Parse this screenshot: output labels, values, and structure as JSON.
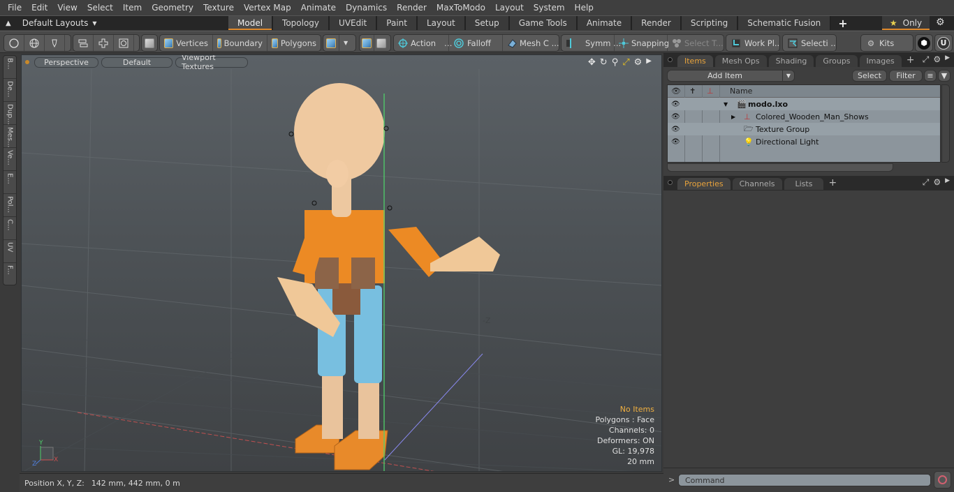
{
  "menu": [
    "File",
    "Edit",
    "View",
    "Select",
    "Item",
    "Geometry",
    "Texture",
    "Vertex Map",
    "Animate",
    "Dynamics",
    "Render",
    "MaxToModo",
    "Layout",
    "System",
    "Help"
  ],
  "layouts": {
    "label": "Default Layouts"
  },
  "layout_tabs": [
    "Model",
    "Topology",
    "UVEdit",
    "Paint",
    "Layout",
    "Setup",
    "Game Tools",
    "Animate",
    "Render",
    "Scripting",
    "Schematic Fusion"
  ],
  "active_layout_tab": "Model",
  "only_label": "Only",
  "toolbar": {
    "vertices": "Vertices",
    "boundary": "Boundary",
    "polygons": "Polygons",
    "action": "Action",
    "falloff": "Falloff",
    "mesh_constraint": "Mesh C ...",
    "symmetry": "Symm ...",
    "snapping": "Snapping",
    "select_tool": "Select T...",
    "work_plane": "Work Pl...",
    "selection_sets": "Selecti ...",
    "kits": "Kits"
  },
  "left_palette": [
    "B...",
    "De...",
    "Dup...",
    "Mes...",
    "Ve...",
    "E...",
    "Pol...",
    "C...",
    "UV",
    "F..."
  ],
  "viewport": {
    "view": "Perspective",
    "shading": "Default",
    "textures": "Viewport Textures",
    "axis_label": "-Z",
    "info": {
      "items": "No Items",
      "polygons": "Polygons : Face",
      "channels": "Channels: 0",
      "deformers": "Deformers: ON",
      "gl": "GL: 19,978",
      "grid": "20 mm"
    }
  },
  "status": {
    "label": "Position X, Y, Z:",
    "value": "142 mm, 442 mm, 0 m"
  },
  "items_panel": {
    "tabs": [
      "Items",
      "Mesh Ops",
      "Shading",
      "Groups",
      "Images"
    ],
    "active_tab": "Items",
    "add_item": "Add Item",
    "select": "Select",
    "filter": "Filter",
    "column_name": "Name",
    "rows": [
      {
        "name": "modo.lxo",
        "icon": "scene-icon",
        "depth": 0
      },
      {
        "name": "Colored_Wooden_Man_Shows",
        "icon": "locator-icon",
        "depth": 1
      },
      {
        "name": "Texture Group",
        "icon": "folder-icon",
        "depth": 1
      },
      {
        "name": "Directional Light",
        "icon": "light-icon",
        "depth": 1
      }
    ]
  },
  "properties_panel": {
    "tabs": [
      "Properties",
      "Channels",
      "Lists"
    ],
    "active_tab": "Properties"
  },
  "command": {
    "placeholder": "Command"
  },
  "colors": {
    "accent": "#e08a2c",
    "active_tab_text": "#e8a33c",
    "info_highlight": "#f0b040"
  }
}
